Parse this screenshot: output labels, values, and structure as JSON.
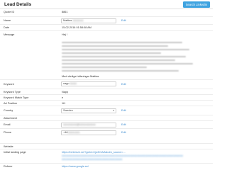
{
  "header": {
    "title": "Lead Details",
    "linkedin_button": "Search LinkedIn"
  },
  "fields": {
    "quote_id": {
      "label": "Quote ID",
      "value": "8861"
    },
    "name": {
      "label": "Name",
      "value": "Mattias"
    },
    "date": {
      "label": "Date",
      "value": "15-02-2016 01:58:08 AM"
    },
    "message": {
      "label": "Message",
      "greeting": "Hej !",
      "signoff": "Med vänliga hälsningar Mattias"
    },
    "keyword": {
      "label": "Keyword",
      "value": "napp"
    },
    "keyword_type": {
      "label": "Keyword Type",
      "value": "Napp"
    },
    "keyword_match_type": {
      "label": "Keyword Match Type",
      "value": "e"
    },
    "ad_position": {
      "label": "Ad Position",
      "value": "1t1"
    },
    "country": {
      "label": "Country",
      "value": "Sweden"
    },
    "attachment": {
      "label": "Attachment"
    },
    "email": {
      "label": "Email",
      "value": ""
    },
    "phone": {
      "label": "Phone",
      "value": "+46"
    },
    "website": {
      "label": "Website"
    },
    "initial_landing_page": {
      "label": "Initial landing page",
      "value": "https://betreeze.se/?gclid=CjwKCAiA&utm_source=..."
    },
    "referer": {
      "label": "Referer",
      "value": "https://www.google.se/"
    }
  },
  "edit_label": "Edit"
}
